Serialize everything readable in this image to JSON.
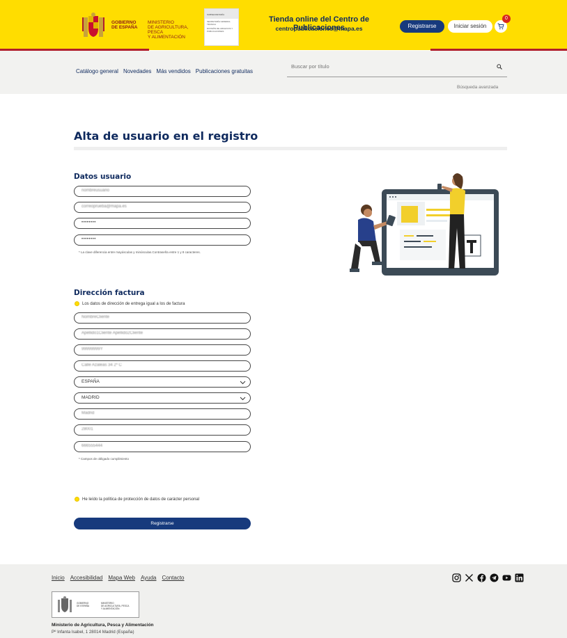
{
  "header": {
    "gob_line1": "GOBIERNO",
    "gob_line2": "DE ESPAÑA",
    "ministry_line1": "MINISTERIO",
    "ministry_line2": "DE AGRICULTURA, PESCA",
    "ministry_line3": "Y ALIMENTACIÓN",
    "subsec_head": "SUBSECRETARÍA",
    "subsec_line1": "SECRETARÍA GENERAL TÉCNICA",
    "subsec_line2": "DIVISIÓN DE ARCHIVOS Y PUBLICACIONES",
    "store_title": "Tienda online del Centro de Publicaciones",
    "store_email": "centropublicaciones@mapa.es",
    "register_label": "Registrarse",
    "login_label": "Iniciar sesión",
    "cart_count": "0",
    "accent_yellow": "#ffdd00",
    "accent_red": "#b01e2c",
    "brand_blue": "#173a7d"
  },
  "nav": {
    "items": [
      "Catálogo general",
      "Novedades",
      "Más vendidos",
      "Publicaciones gratuitas"
    ],
    "search_placeholder": "Buscar por título",
    "advanced_search": "Búsqueda avanzada"
  },
  "form": {
    "page_title": "Alta de usuario en el registro",
    "user_section": "Datos usuario",
    "username": "nombreusuario",
    "email": "correoprueba@mapa.es",
    "password": "••••••••",
    "password_repeat": "••••••••",
    "password_note": "* La clave diferencia entre mayúsculas y minúsculas.Contraseña entre 1 y 8 caracteres.",
    "billing_section": "Dirección factura",
    "same_address_label": "Los datos de dirección de entrega igual a los de factura",
    "first_name": "NombreCliente",
    "surnames": "Apellido1Cliente Apellido2Cliente",
    "nif": "99999999Y",
    "address": "Calle Azaleas 34 2º C",
    "country": "ESPAÑA",
    "province": "MADRID",
    "city": "Madrid",
    "postal_code": "28001",
    "phone": "666555444",
    "required_note": "* Campos de obligado cumplimiento",
    "privacy_label": "He leído la política de protección de datos de carácter personal",
    "submit_label": "Registrarse"
  },
  "footer": {
    "links": [
      "Inicio",
      "Accesibilidad",
      "Mapa Web",
      "Ayuda",
      "Contacto"
    ],
    "social_icons": [
      "instagram-icon",
      "x-icon",
      "facebook-icon",
      "telegram-icon",
      "youtube-icon",
      "linkedin-icon"
    ],
    "logo_gob_line1": "GOBIERNO",
    "logo_gob_line2": "DE ESPAÑA",
    "logo_min_line1": "MINISTERIO",
    "logo_min_line2": "DE AGRICULTURA, PESCA",
    "logo_min_line3": "Y ALIMENTACIÓN",
    "org_name": "Ministerio de Agricultura, Pesca y Alimentación",
    "address": "Pº Infanta Isabel, 1 28014 Madrid (España)"
  }
}
